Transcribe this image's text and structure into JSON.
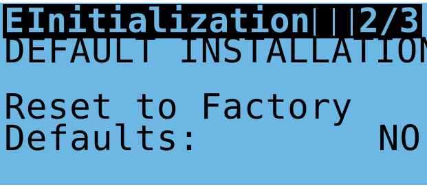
{
  "title_bar": {
    "marker": "E",
    "title": "Initialization",
    "page": "2/3"
  },
  "screen": {
    "heading": "DEFAULT INSTALLATION",
    "prompt_line1": "Reset to Factory",
    "prompt_line2": "Defaults:",
    "value": "NO"
  }
}
